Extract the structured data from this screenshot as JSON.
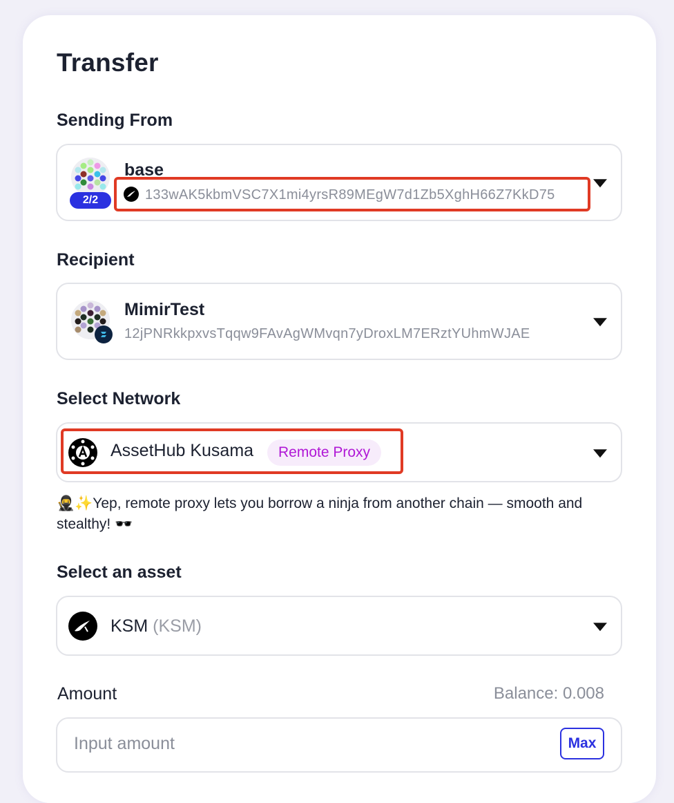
{
  "page": {
    "title": "Transfer"
  },
  "sending_from": {
    "label": "Sending From",
    "account_name": "base",
    "threshold_badge": "2/2",
    "address": "133wAK5kbmVSC7X1mi4yrsR89MEgW7d1Zb5XghH66Z7KkD75",
    "chain_icon": "kusama-icon",
    "highlight_color": "#e03a24"
  },
  "recipient": {
    "label": "Recipient",
    "account_name": "MimirTest",
    "address": "12jPNRkkpxvsTqqw9FAvAgWMvqn7yDroxLM7ERztYUhmWJAE"
  },
  "network": {
    "label": "Select Network",
    "selected_name": "AssetHub Kusama",
    "tag": "Remote Proxy",
    "tag_color": "#b018d6",
    "note": "🥷✨Yep, remote proxy lets you borrow a ninja from another chain — smooth and stealthy! 🕶️"
  },
  "asset": {
    "label": "Select an asset",
    "name": "KSM",
    "symbol": "(KSM)",
    "icon": "kusama-icon"
  },
  "amount": {
    "label": "Amount",
    "balance": "Balance: 0.008",
    "placeholder": "Input amount",
    "max_label": "Max",
    "accent_color": "#2b31e0"
  }
}
